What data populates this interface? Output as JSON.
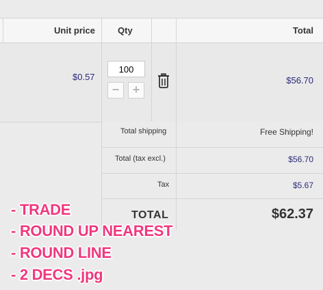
{
  "header": {
    "unit_price": "Unit price",
    "qty": "Qty",
    "total": "Total"
  },
  "product": {
    "unit_price": "$0.57",
    "quantity": "100",
    "decrement": "−",
    "increment": "+",
    "total": "$56.70"
  },
  "summary": {
    "shipping_label": "Total shipping",
    "shipping_value": "Free Shipping!",
    "tax_excl_label": "Total (tax excl.)",
    "tax_excl_value": "$56.70",
    "tax_label": "Tax",
    "tax_value": "$5.67",
    "total_label": "TOTAL",
    "total_value": "$62.37"
  },
  "annotations": [
    "- TRADE",
    "- ROUND UP NEAREST",
    "- ROUND LINE",
    "- 2 DECS .jpg"
  ],
  "colors": {
    "price_text": "#2a2a7a",
    "annotation_text": "#f0387e",
    "border": "#d6d4d4"
  },
  "icons": {
    "delete": "trash-icon"
  }
}
